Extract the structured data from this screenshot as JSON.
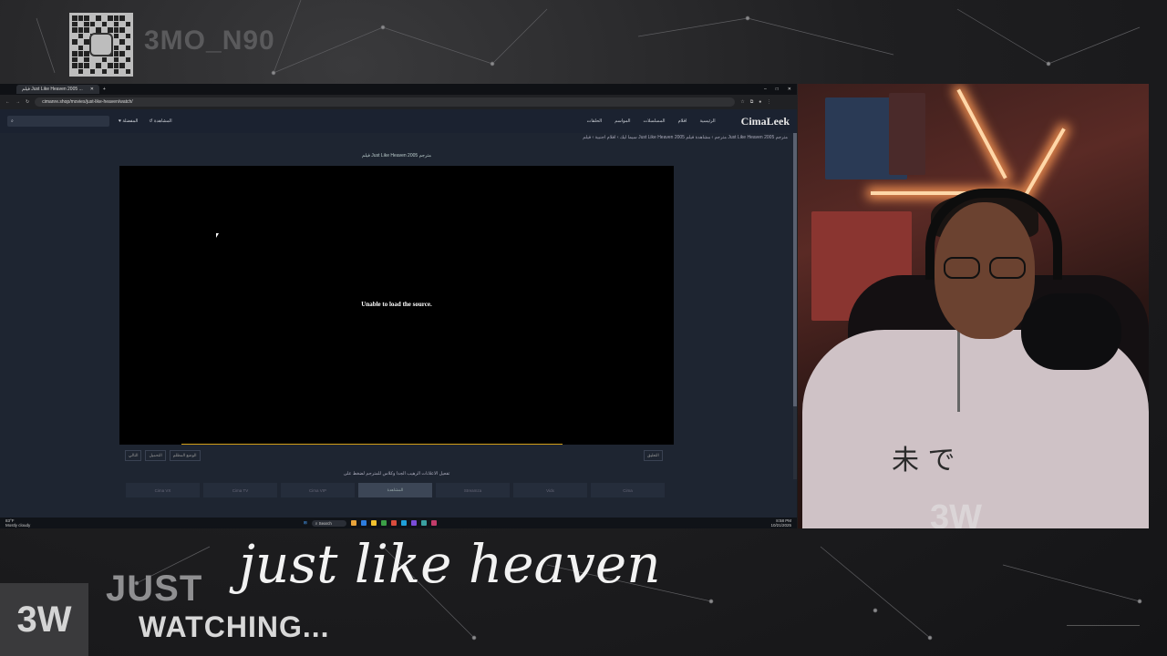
{
  "overlay": {
    "handle": "3MO_N90",
    "just": "JUST",
    "watching": "WATCHING...",
    "movie_title": "just like heaven",
    "logo": "3W",
    "cam_logo": "3W"
  },
  "browser": {
    "tab_title": "فيلم Just Like Heaven 2005 ...",
    "url": "cimanre.shop/movies/just-like-heaven/watch/",
    "search_placeholder": "",
    "header_icons": [
      "المفضلة",
      "المشاهدة"
    ],
    "nav": [
      "الرئيسية",
      "افلام",
      "المسلسلات",
      "المواسم",
      "الحلقات"
    ],
    "logo": "CimaLeek",
    "breadcrumb": "سيما ليك  ›  افلام اجنبية  ›  فيلم Just Like Heaven 2005 مترجم  ›  مشاهدة فيلم Just Like Heaven 2005 مترجم",
    "page_title": "فيلم Just Like Heaven 2005 مترجم",
    "player_error": "Unable to load the source.",
    "player_buttons": [
      "التالي",
      "التحميل",
      "الوضع المظلم"
    ],
    "player_button_right": "التعليق",
    "note": "تفعيل الاعلانات الرهيب الجدا وكلاس للمترجم لضغط على",
    "servers": [
      "Cima",
      "Vidx",
      "Streamza",
      "المشاهدة",
      "Cima VIP",
      "Cima TV",
      "Cima VX"
    ],
    "active_server_index": 3
  },
  "taskbar": {
    "weather_temp": "83°F",
    "weather_desc": "Mostly cloudy",
    "search_label": "Search",
    "time": "8:58 PM",
    "date": "10/21/2025"
  }
}
